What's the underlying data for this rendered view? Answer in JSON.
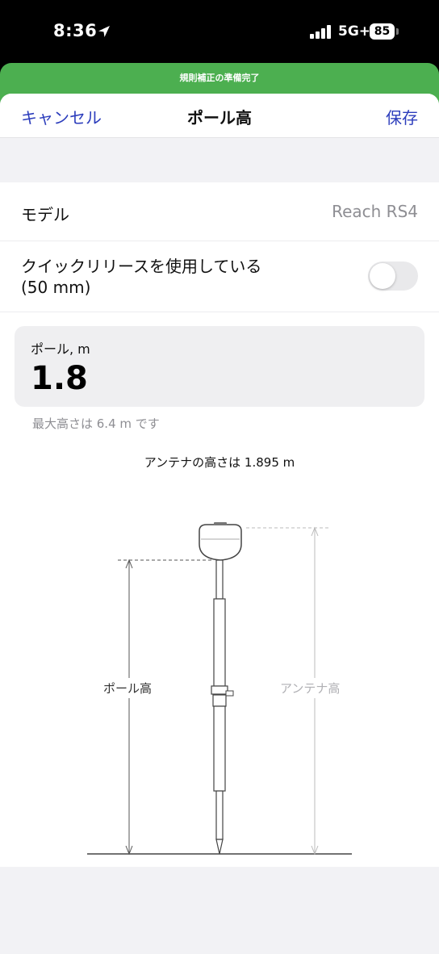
{
  "status_bar": {
    "time": "8:36",
    "network": "5G+",
    "battery": "85"
  },
  "banner": {
    "text": "規則補正の準備完了"
  },
  "nav": {
    "cancel": "キャンセル",
    "title": "ポール高",
    "save": "保存"
  },
  "model_row": {
    "label": "モデル",
    "value": "Reach RS4"
  },
  "quick_release": {
    "line1": "クイックリリースを使用している",
    "line2": "(50 mm)",
    "enabled": false
  },
  "pole_field": {
    "label": "ポール, m",
    "value": "1.8"
  },
  "max_height_text": "最大高さは 6.4 m です",
  "antenna_height_text": "アンテナの高さは 1.895 m",
  "diagram": {
    "pole_height_label": "ポール高",
    "antenna_height_label": "アンテナ高"
  },
  "colors": {
    "accent": "#2c3dbc",
    "banner": "#4caf50"
  }
}
